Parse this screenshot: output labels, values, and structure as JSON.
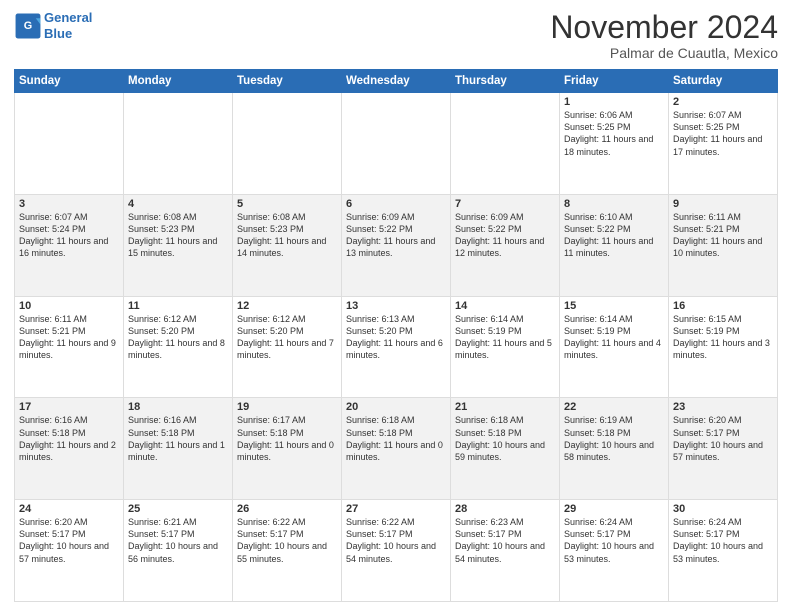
{
  "logo": {
    "line1": "General",
    "line2": "Blue"
  },
  "title": "November 2024",
  "location": "Palmar de Cuautla, Mexico",
  "days_of_week": [
    "Sunday",
    "Monday",
    "Tuesday",
    "Wednesday",
    "Thursday",
    "Friday",
    "Saturday"
  ],
  "weeks": [
    [
      {
        "day": "",
        "info": ""
      },
      {
        "day": "",
        "info": ""
      },
      {
        "day": "",
        "info": ""
      },
      {
        "day": "",
        "info": ""
      },
      {
        "day": "",
        "info": ""
      },
      {
        "day": "1",
        "info": "Sunrise: 6:06 AM\nSunset: 5:25 PM\nDaylight: 11 hours and 18 minutes."
      },
      {
        "day": "2",
        "info": "Sunrise: 6:07 AM\nSunset: 5:25 PM\nDaylight: 11 hours and 17 minutes."
      }
    ],
    [
      {
        "day": "3",
        "info": "Sunrise: 6:07 AM\nSunset: 5:24 PM\nDaylight: 11 hours and 16 minutes."
      },
      {
        "day": "4",
        "info": "Sunrise: 6:08 AM\nSunset: 5:23 PM\nDaylight: 11 hours and 15 minutes."
      },
      {
        "day": "5",
        "info": "Sunrise: 6:08 AM\nSunset: 5:23 PM\nDaylight: 11 hours and 14 minutes."
      },
      {
        "day": "6",
        "info": "Sunrise: 6:09 AM\nSunset: 5:22 PM\nDaylight: 11 hours and 13 minutes."
      },
      {
        "day": "7",
        "info": "Sunrise: 6:09 AM\nSunset: 5:22 PM\nDaylight: 11 hours and 12 minutes."
      },
      {
        "day": "8",
        "info": "Sunrise: 6:10 AM\nSunset: 5:22 PM\nDaylight: 11 hours and 11 minutes."
      },
      {
        "day": "9",
        "info": "Sunrise: 6:11 AM\nSunset: 5:21 PM\nDaylight: 11 hours and 10 minutes."
      }
    ],
    [
      {
        "day": "10",
        "info": "Sunrise: 6:11 AM\nSunset: 5:21 PM\nDaylight: 11 hours and 9 minutes."
      },
      {
        "day": "11",
        "info": "Sunrise: 6:12 AM\nSunset: 5:20 PM\nDaylight: 11 hours and 8 minutes."
      },
      {
        "day": "12",
        "info": "Sunrise: 6:12 AM\nSunset: 5:20 PM\nDaylight: 11 hours and 7 minutes."
      },
      {
        "day": "13",
        "info": "Sunrise: 6:13 AM\nSunset: 5:20 PM\nDaylight: 11 hours and 6 minutes."
      },
      {
        "day": "14",
        "info": "Sunrise: 6:14 AM\nSunset: 5:19 PM\nDaylight: 11 hours and 5 minutes."
      },
      {
        "day": "15",
        "info": "Sunrise: 6:14 AM\nSunset: 5:19 PM\nDaylight: 11 hours and 4 minutes."
      },
      {
        "day": "16",
        "info": "Sunrise: 6:15 AM\nSunset: 5:19 PM\nDaylight: 11 hours and 3 minutes."
      }
    ],
    [
      {
        "day": "17",
        "info": "Sunrise: 6:16 AM\nSunset: 5:18 PM\nDaylight: 11 hours and 2 minutes."
      },
      {
        "day": "18",
        "info": "Sunrise: 6:16 AM\nSunset: 5:18 PM\nDaylight: 11 hours and 1 minute."
      },
      {
        "day": "19",
        "info": "Sunrise: 6:17 AM\nSunset: 5:18 PM\nDaylight: 11 hours and 0 minutes."
      },
      {
        "day": "20",
        "info": "Sunrise: 6:18 AM\nSunset: 5:18 PM\nDaylight: 11 hours and 0 minutes."
      },
      {
        "day": "21",
        "info": "Sunrise: 6:18 AM\nSunset: 5:18 PM\nDaylight: 10 hours and 59 minutes."
      },
      {
        "day": "22",
        "info": "Sunrise: 6:19 AM\nSunset: 5:18 PM\nDaylight: 10 hours and 58 minutes."
      },
      {
        "day": "23",
        "info": "Sunrise: 6:20 AM\nSunset: 5:17 PM\nDaylight: 10 hours and 57 minutes."
      }
    ],
    [
      {
        "day": "24",
        "info": "Sunrise: 6:20 AM\nSunset: 5:17 PM\nDaylight: 10 hours and 57 minutes."
      },
      {
        "day": "25",
        "info": "Sunrise: 6:21 AM\nSunset: 5:17 PM\nDaylight: 10 hours and 56 minutes."
      },
      {
        "day": "26",
        "info": "Sunrise: 6:22 AM\nSunset: 5:17 PM\nDaylight: 10 hours and 55 minutes."
      },
      {
        "day": "27",
        "info": "Sunrise: 6:22 AM\nSunset: 5:17 PM\nDaylight: 10 hours and 54 minutes."
      },
      {
        "day": "28",
        "info": "Sunrise: 6:23 AM\nSunset: 5:17 PM\nDaylight: 10 hours and 54 minutes."
      },
      {
        "day": "29",
        "info": "Sunrise: 6:24 AM\nSunset: 5:17 PM\nDaylight: 10 hours and 53 minutes."
      },
      {
        "day": "30",
        "info": "Sunrise: 6:24 AM\nSunset: 5:17 PM\nDaylight: 10 hours and 53 minutes."
      }
    ]
  ]
}
